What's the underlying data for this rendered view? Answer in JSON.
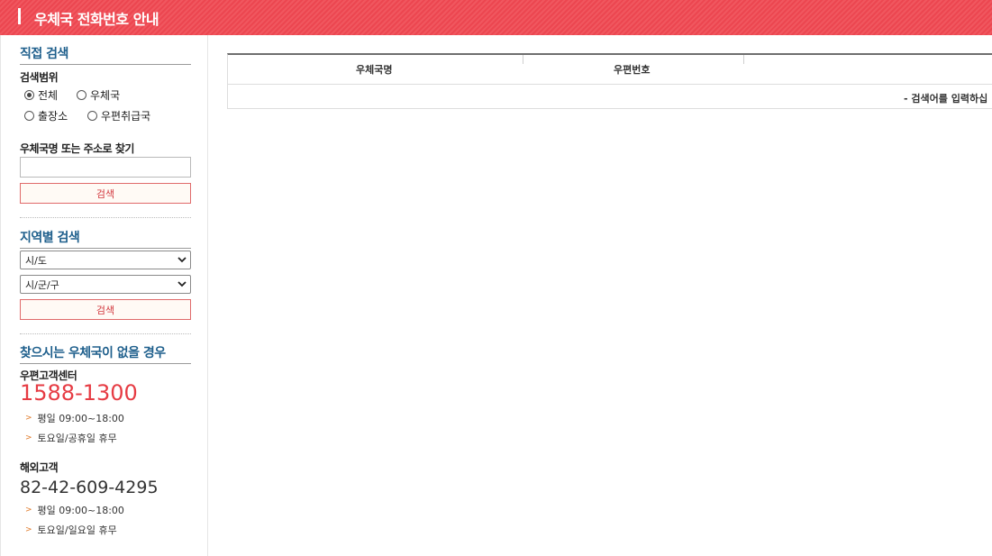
{
  "header": {
    "title": "우체국 전화번호 안내"
  },
  "direct_search": {
    "title": "직접 검색",
    "scope_label": "검색범위",
    "scope_options": [
      {
        "label": "전체",
        "selected": true
      },
      {
        "label": "우체국",
        "selected": false
      },
      {
        "label": "출장소",
        "selected": false
      },
      {
        "label": "우편취급국",
        "selected": false
      }
    ],
    "query_label": "우체국명 또는 주소로 찾기",
    "query_value": "",
    "search_button": "검색"
  },
  "region_search": {
    "title": "지역별 검색",
    "sido": "시/도",
    "sigungu": "시/군/구",
    "search_button": "검색"
  },
  "help": {
    "title": "찾으시는 우체국이 없을 경우",
    "domestic_label": "우편고객센터",
    "domestic_phone": "1588-1300",
    "domestic_hours": [
      "평일 09:00~18:00",
      "토요일/공휴일 휴무"
    ],
    "overseas_label": "해외고객",
    "overseas_phone": "82-42-609-4295",
    "overseas_hours": [
      "평일 09:00~18:00",
      "토요일/일요일 휴무"
    ]
  },
  "results": {
    "columns": [
      "우체국명",
      "우편번호"
    ],
    "empty_message": "- 검색어를 입력하십"
  },
  "colors": {
    "brand_red": "#ec4650",
    "section_blue": "#1e5f8c"
  }
}
